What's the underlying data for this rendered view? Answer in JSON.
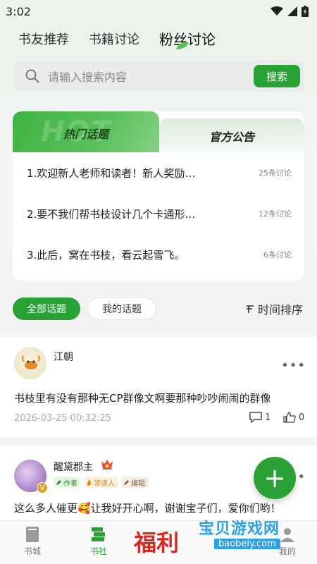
{
  "status": {
    "time": "3:02"
  },
  "tabs": [
    "书友推荐",
    "书籍讨论",
    "粉丝讨论"
  ],
  "search": {
    "placeholder": "请输入搜索内容",
    "button": "搜索"
  },
  "topic_card": {
    "tab_hot": "热门话题",
    "tab_hot_ghost": "HOT",
    "tab_notice": "官方公告",
    "items": [
      {
        "title": "1.欢迎新人老师和读者！新人奖励…",
        "count": "25条讨论"
      },
      {
        "title": "2.要不我们帮书枝设计几个卡通形…",
        "count": "12条讨论"
      },
      {
        "title": "3.此后，窝在书枝，看云起雪飞。",
        "count": "6条讨论"
      }
    ]
  },
  "filters": {
    "all": "全部话题",
    "mine": "我的话题",
    "sort": "时间排序"
  },
  "posts": [
    {
      "name": "江朝",
      "text": "书枝里有没有那种无CP群像文啊要那种吵吵闹闹的群像",
      "date": "2026-03-25 00:32:25",
      "comments": "1",
      "likes": "0"
    },
    {
      "name": "醒黛郡主",
      "badges": [
        "作者",
        "领读人",
        "编辑"
      ],
      "v": "V",
      "text": "这么多人催更🥰让我好开心啊，谢谢宝子们，爱你们哟！"
    }
  ],
  "nav": {
    "store": "书城",
    "community": "书社",
    "welfare": "福利",
    "mine": "我的"
  },
  "watermark": {
    "title": "宝贝游戏网",
    "url": "baobeiy.com"
  },
  "colors": {
    "accent": "#2aa135",
    "welfare": "#d9261f"
  }
}
